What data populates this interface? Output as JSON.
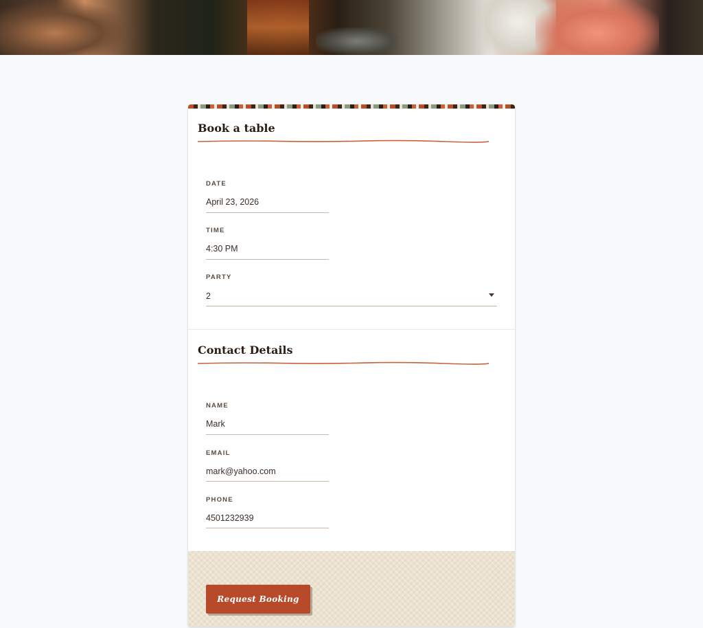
{
  "booking": {
    "title": "Book a table",
    "fields": {
      "date": {
        "label": "DATE",
        "value": "April 23, 2026"
      },
      "time": {
        "label": "TIME",
        "value": "4:30 PM"
      },
      "party": {
        "label": "PARTY",
        "value": "2"
      }
    }
  },
  "contact": {
    "title": "Contact Details",
    "fields": {
      "name": {
        "label": "NAME",
        "value": "Mark"
      },
      "email": {
        "label": "EMAIL",
        "value": "mark@yahoo.com"
      },
      "phone": {
        "label": "PHONE",
        "value": "4501232939"
      }
    }
  },
  "footer": {
    "submit_label": "Request Booking"
  },
  "colors": {
    "accent": "#b84a2c",
    "underline": "#c8623a",
    "footer_bg": "#ece2d0"
  }
}
